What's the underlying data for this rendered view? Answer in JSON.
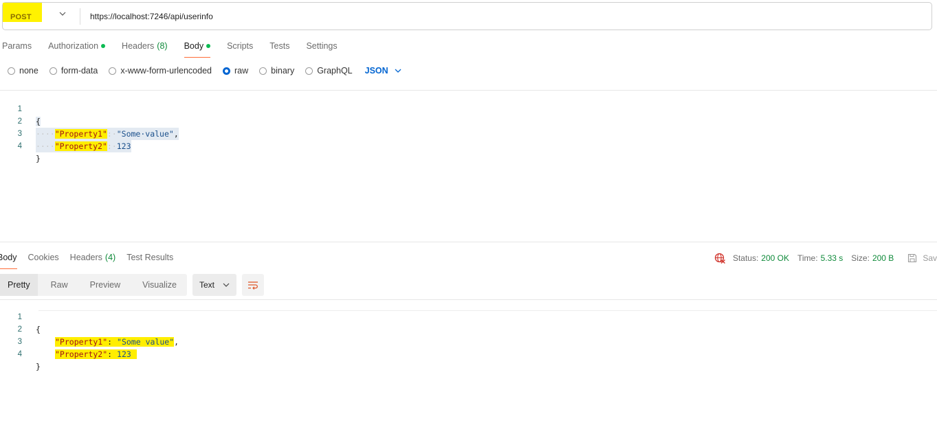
{
  "request": {
    "method": "POST",
    "url": "https://localhost:7246/api/userinfo",
    "tabs": [
      {
        "label": "Params",
        "count": "",
        "dot": false,
        "active": false
      },
      {
        "label": "Authorization",
        "count": "",
        "dot": true,
        "active": false
      },
      {
        "label": "Headers",
        "count": "(8)",
        "dot": false,
        "active": false
      },
      {
        "label": "Body",
        "count": "",
        "dot": true,
        "active": true
      },
      {
        "label": "Scripts",
        "count": "",
        "dot": false,
        "active": false
      },
      {
        "label": "Tests",
        "count": "",
        "dot": false,
        "active": false
      },
      {
        "label": "Settings",
        "count": "",
        "dot": false,
        "active": false
      }
    ],
    "body_types": [
      "none",
      "form-data",
      "x-www-form-urlencoded",
      "raw",
      "binary",
      "GraphQL"
    ],
    "body_type_selected": "raw",
    "body_format": "JSON",
    "body_lines": [
      "1",
      "2",
      "3",
      "4"
    ],
    "body_code": {
      "open": "{",
      "indent": "····",
      "key1": "\"Property1\"",
      "colon": ":·",
      "val1": "\"Some·value\"",
      "comma": ",",
      "key2": "\"Property2\"",
      "val2": "123",
      "close": "}"
    }
  },
  "response": {
    "tabs": [
      {
        "label": "Body",
        "count": "",
        "active": true
      },
      {
        "label": "Cookies",
        "count": "",
        "active": false
      },
      {
        "label": "Headers",
        "count": "(4)",
        "active": false
      },
      {
        "label": "Test Results",
        "count": "",
        "active": false
      }
    ],
    "status_label": "Status:",
    "status_value": "200 OK",
    "time_label": "Time:",
    "time_value": "5.33 s",
    "size_label": "Size:",
    "size_value": "200 B",
    "save_label": "Sav",
    "view_modes": [
      "Pretty",
      "Raw",
      "Preview",
      "Visualize"
    ],
    "view_mode_active": "Pretty",
    "format": "Text",
    "body_lines": [
      "1",
      "2",
      "3",
      "4"
    ],
    "body_code": {
      "open": "{",
      "key1": "\"Property1\"",
      "colon": ": ",
      "val1": "\"Some value\"",
      "comma": ",",
      "key2": "\"Property2\"",
      "val2": "123",
      "close": "}"
    }
  },
  "icons": {
    "method_chevron": "chevron-down-icon",
    "format_chevron": "chevron-down-icon",
    "globe": "globe-error-icon",
    "save": "save-icon",
    "wrap": "wrap-lines-icon"
  },
  "colors": {
    "accent_orange": "#ff6c37",
    "active_blue": "#0265d2",
    "success_green": "#0f8a3a",
    "dot_green": "#0cbb52",
    "highlight_yellow": "#fff200"
  }
}
